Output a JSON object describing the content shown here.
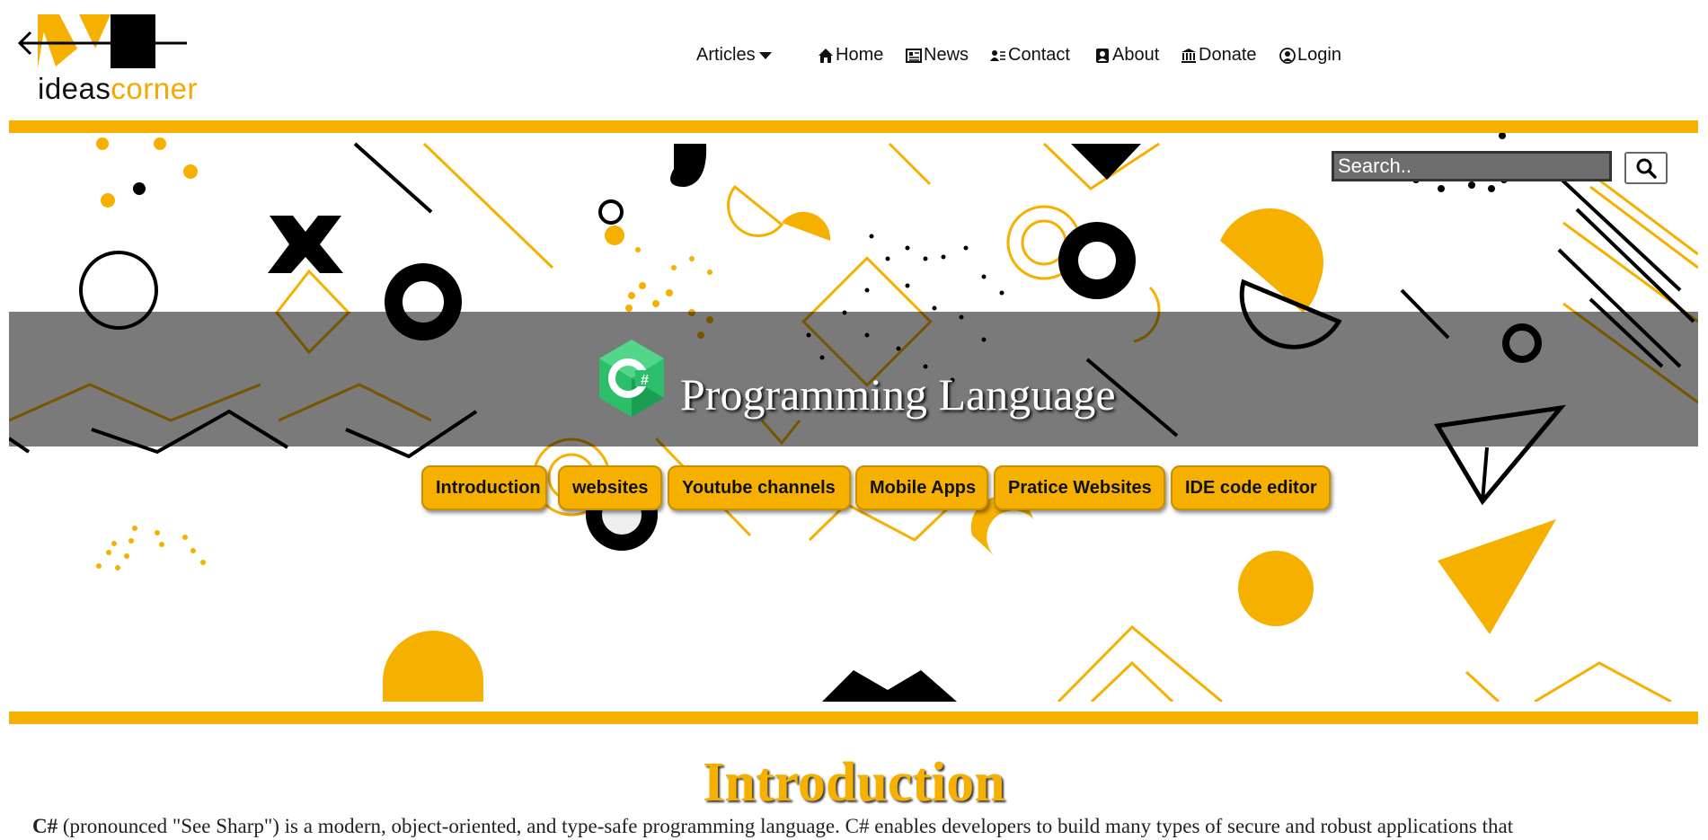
{
  "brand": {
    "logo_word1": "ideas",
    "logo_word2": "corner",
    "colors": {
      "accent": "#f6b000",
      "dark": "#000000"
    }
  },
  "nav": {
    "articles": "Articles",
    "home": "Home",
    "news": "News",
    "contact": "Contact",
    "about": "About",
    "donate": "Donate",
    "login": "Login"
  },
  "search": {
    "placeholder": "Search..",
    "icon": "search-icon"
  },
  "hero": {
    "title": "Programming Language",
    "logo_icon": "csharp-logo"
  },
  "tabs": [
    "Introduction",
    "websites",
    "Youtube channels",
    "Mobile Apps",
    "Pratice Websites",
    "IDE code editor"
  ],
  "intro": {
    "title": "Introduction",
    "lead": "C#",
    "text": " (pronounced \"See Sharp\") is a modern, object-oriented, and type-safe programming language. C# enables developers to build many types of secure and robust applications that"
  }
}
